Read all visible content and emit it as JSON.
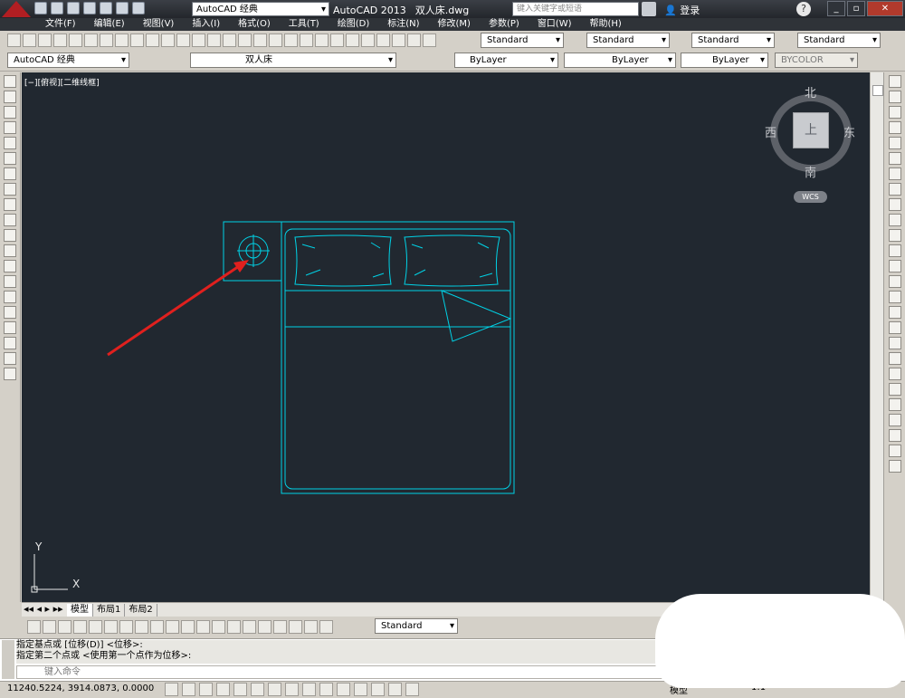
{
  "titlebar": {
    "workspace": "AutoCAD 经典",
    "app": "AutoCAD 2013",
    "file": "双人床.dwg",
    "search_placeholder": "键入关键字或短语",
    "login": "登录",
    "help": "?"
  },
  "menu": [
    "文件(F)",
    "编辑(E)",
    "视图(V)",
    "插入(I)",
    "格式(O)",
    "工具(T)",
    "绘图(D)",
    "标注(N)",
    "修改(M)",
    "参数(P)",
    "窗口(W)",
    "帮助(H)"
  ],
  "styles": {
    "text_style": "Standard",
    "dim_style": "Standard",
    "table_style": "Standard",
    "multileader_style": "Standard"
  },
  "layers": {
    "workspace": "AutoCAD 经典",
    "current_layer": "双人床",
    "color": "ByLayer",
    "linetype": "ByLayer",
    "lineweight": "ByLayer",
    "plotstyle": "BYCOLOR"
  },
  "viewport": {
    "label": "[−][俯视][二维线框]",
    "north": "北",
    "south": "南",
    "west": "西",
    "east": "东",
    "top": "上",
    "wcs": "WCS",
    "ucs_x": "X",
    "ucs_y": "Y"
  },
  "tabs": [
    "模型",
    "布局1",
    "布局2"
  ],
  "dim_toolbar_style": "Standard",
  "command": {
    "line1": "指定基点或 [位移(D)] <位移>:",
    "line2": "指定第二个点或 <使用第一个点作为位移>:",
    "input_placeholder": "键入命令"
  },
  "status": {
    "coords": "11240.5224, 3914.0873, 0.0000",
    "scale": "1:1",
    "model": "模型"
  },
  "colors": {
    "drawing_lines": "#00d2e6",
    "arrow": "#e0201e",
    "background": "#212830"
  }
}
